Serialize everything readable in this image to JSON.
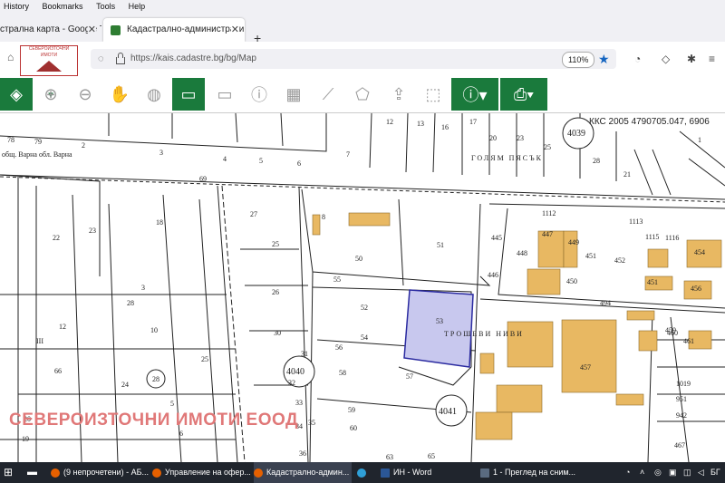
{
  "menu": [
    "History",
    "Bookmarks",
    "Tools",
    "Help"
  ],
  "tabs": [
    {
      "label": "стрална карта - Google Тъ"
    },
    {
      "label": "Кадастрално-административ"
    }
  ],
  "url": "https://kais.cadastre.bg/bg/Map",
  "zoom": "110%",
  "logo_text": "СЕВЕРОИЗТОЧНИ ИМОТИ",
  "kks_label": "ККС 2005 4790705.047, 6906",
  "map": {
    "region_labels": [
      "общ. Варна обл. Варна",
      "ГОЛЯМ ПЯСЪК",
      "ТРОШЕВИ НИВИ"
    ],
    "circle_labels": [
      "4039",
      "4040",
      "4041"
    ],
    "parcel_labels": [
      "78",
      "79",
      "2",
      "3",
      "4",
      "5",
      "6",
      "7",
      "8",
      "12",
      "13",
      "16",
      "17",
      "20",
      "23",
      "25",
      "28",
      "21",
      "1",
      "69",
      "22",
      "23",
      "18",
      "28",
      "3",
      "10",
      "12",
      "III",
      "66",
      "24",
      "28",
      "25",
      "5",
      "6",
      "20",
      "19",
      "27",
      "25",
      "26",
      "30",
      "31",
      "32",
      "33",
      "34",
      "35",
      "36",
      "50",
      "51",
      "52",
      "53",
      "54",
      "55",
      "56",
      "57",
      "58",
      "59",
      "60",
      "63",
      "65",
      "445",
      "446",
      "447",
      "448",
      "449",
      "450",
      "451",
      "452",
      "454",
      "459",
      "460",
      "461",
      "467",
      "494",
      "1019",
      "1112",
      "1113",
      "1115",
      "1116",
      "457",
      "451",
      "456",
      "951",
      "942"
    ],
    "watermark": "СЕВЕРОИЗТОЧНИ ИМОТИ ЕООД"
  },
  "taskbar": [
    {
      "label": "(9 непрочетени) - АБ..."
    },
    {
      "label": "Управление на офер..."
    },
    {
      "label": "Кадастрално-админ..."
    },
    {
      "label": "ИН - Word"
    },
    {
      "label": "1 - Преглед на сним..."
    }
  ],
  "tray_lang": "БГ",
  "colors": {
    "accent": "#1a7a3c",
    "highlight": "#c8c8ee",
    "building": "#e8b862",
    "watermark": "#e07878"
  }
}
